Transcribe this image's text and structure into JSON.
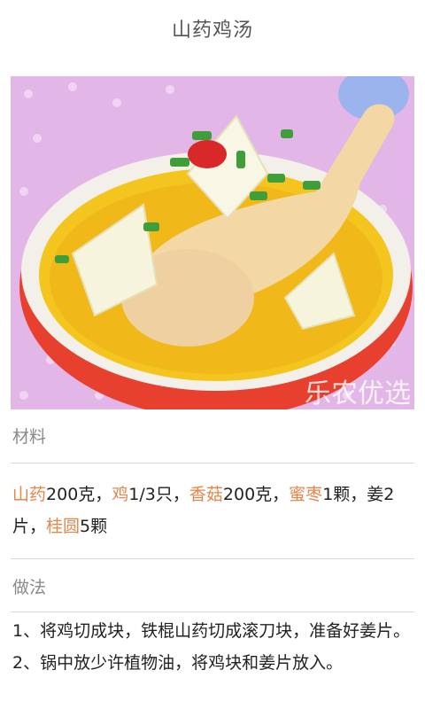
{
  "header": {
    "title": "山药鸡汤"
  },
  "hero": {
    "watermark": "乐农优选"
  },
  "materials": {
    "heading": "材料",
    "items": [
      {
        "name": "山药",
        "qty": "200克，"
      },
      {
        "name": "鸡",
        "qty": "1/3只，"
      },
      {
        "name": "香菇",
        "qty": "200克，"
      },
      {
        "name": "蜜枣",
        "qty": "1颗，姜2片，"
      },
      {
        "name": "桂圆",
        "qty": "5颗"
      }
    ]
  },
  "method": {
    "heading": "做法",
    "steps": [
      "1、将鸡切成块，铁棍山药切成滚刀块，准备好姜片。",
      "2、锅中放少许植物油，将鸡块和姜片放入。"
    ]
  },
  "colors": {
    "highlight": "#e4864b",
    "label": "#8a8a8a",
    "divider": "#d9d9d9"
  }
}
